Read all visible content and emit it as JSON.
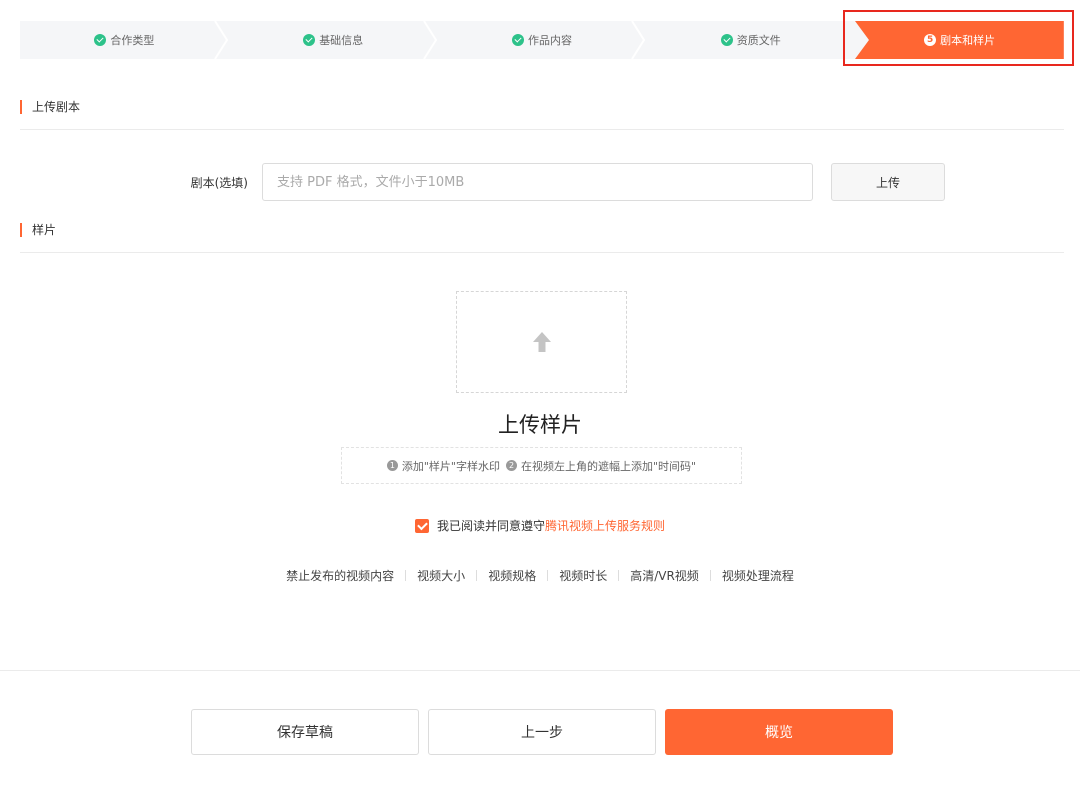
{
  "stepper": {
    "steps": [
      {
        "label": "合作类型",
        "status": "done"
      },
      {
        "label": "基础信息",
        "status": "done"
      },
      {
        "label": "作品内容",
        "status": "done"
      },
      {
        "label": "资质文件",
        "status": "done"
      },
      {
        "label": "剧本和样片",
        "status": "active",
        "number": "5"
      }
    ]
  },
  "script_section": {
    "title": "上传剧本",
    "field_label": "剧本(选填)",
    "placeholder": "支持 PDF 格式，文件小于10MB",
    "upload_label": "上传"
  },
  "sample_section": {
    "title": "样片",
    "upload_title": "上传样片",
    "hints": [
      {
        "num": "1",
        "text": "添加\"样片\"字样水印"
      },
      {
        "num": "2",
        "text": "在视频左上角的遮幅上添加\"时间码\""
      }
    ],
    "agree_text": "我已阅读并同意遵守",
    "agree_link": "腾讯视频上传服务规则",
    "links": [
      "禁止发布的视频内容",
      "视频大小",
      "视频规格",
      "视频时长",
      "高清/VR视频",
      "视频处理流程"
    ]
  },
  "footer": {
    "save_draft": "保存草稿",
    "prev": "上一步",
    "preview": "概览"
  },
  "colors": {
    "accent": "#ff6633",
    "done": "#2dc28a",
    "highlight": "#e8281e"
  }
}
